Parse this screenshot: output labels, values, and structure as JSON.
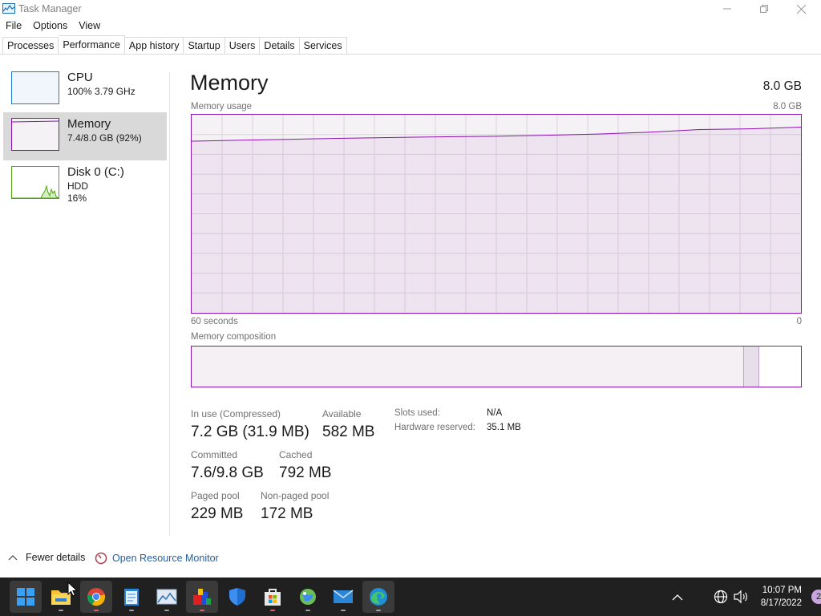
{
  "window": {
    "title": "Task Manager",
    "minimize_icon": "minimize-icon",
    "maximize_icon": "restore-icon",
    "close_icon": "close-icon"
  },
  "menu": [
    "File",
    "Options",
    "View"
  ],
  "tabs": [
    {
      "label": "Processes",
      "active": false
    },
    {
      "label": "Performance",
      "active": true
    },
    {
      "label": "App history",
      "active": false
    },
    {
      "label": "Startup",
      "active": false
    },
    {
      "label": "Users",
      "active": false
    },
    {
      "label": "Details",
      "active": false
    },
    {
      "label": "Services",
      "active": false
    }
  ],
  "sidebar": {
    "items": [
      {
        "name": "CPU",
        "line1": "100% 3.79 GHz",
        "line2": "",
        "selected": false,
        "color": "#1a7fd1"
      },
      {
        "name": "Memory",
        "line1": "7.4/8.0 GB (92%)",
        "line2": "",
        "selected": true,
        "color": "#8b12ae"
      },
      {
        "name": "Disk 0 (C:)",
        "line1": "HDD",
        "line2": "16%",
        "selected": false,
        "color": "#4da60c"
      }
    ]
  },
  "main": {
    "title": "Memory",
    "total": "8.0 GB",
    "usage_label": "Memory usage",
    "usage_max": "8.0 GB",
    "time_left": "60 seconds",
    "time_right": "0",
    "composition_label": "Memory composition",
    "accent_color": "#8b12ae"
  },
  "chart_data": {
    "type": "line",
    "title": "Memory usage",
    "xlabel": "",
    "ylabel": "",
    "x": [
      60,
      55,
      50,
      45,
      40,
      35,
      30,
      25,
      20,
      15,
      10,
      5,
      0
    ],
    "series": [
      {
        "values": [
          6.93,
          6.97,
          7.01,
          7.05,
          7.08,
          7.11,
          7.13,
          7.17,
          7.22,
          7.29,
          7.4,
          7.43,
          7.5
        ]
      }
    ],
    "ylim": [
      0,
      8.0
    ],
    "grid": true
  },
  "stats": {
    "in_use_label": "In use (Compressed)",
    "in_use_value": "7.2 GB (31.9 MB)",
    "available_label": "Available",
    "available_value": "582 MB",
    "committed_label": "Committed",
    "committed_value": "7.6/9.8 GB",
    "cached_label": "Cached",
    "cached_value": "792 MB",
    "paged_label": "Paged pool",
    "paged_value": "229 MB",
    "nonpaged_label": "Non-paged pool",
    "nonpaged_value": "172 MB",
    "slots_label": "Slots used:",
    "slots_value": "N/A",
    "hw_label": "Hardware reserved:",
    "hw_value": "35.1 MB"
  },
  "footer": {
    "fewer_details": "Fewer details",
    "resource_monitor": "Open Resource Monitor"
  },
  "taskbar": {
    "apps": [
      {
        "name": "start-icon",
        "active": true,
        "dot": ""
      },
      {
        "name": "file-explorer-icon",
        "active": false,
        "dot": "gray"
      },
      {
        "name": "chrome-icon",
        "active": true,
        "dot": "red"
      },
      {
        "name": "notepad-icon",
        "active": false,
        "dot": "gray"
      },
      {
        "name": "photos-icon",
        "active": false,
        "dot": "gray"
      },
      {
        "name": "paint-app-icon",
        "active": true,
        "dot": "red"
      },
      {
        "name": "security-icon",
        "active": false,
        "dot": ""
      },
      {
        "name": "store-icon",
        "active": false,
        "dot": "red"
      },
      {
        "name": "maps-icon",
        "active": false,
        "dot": "gray"
      },
      {
        "name": "mail-icon",
        "active": false,
        "dot": "gray"
      },
      {
        "name": "edge-icon",
        "active": true,
        "dot": "gray"
      }
    ],
    "time": "10:07 PM",
    "date": "8/17/2022",
    "notification_count": "2"
  }
}
